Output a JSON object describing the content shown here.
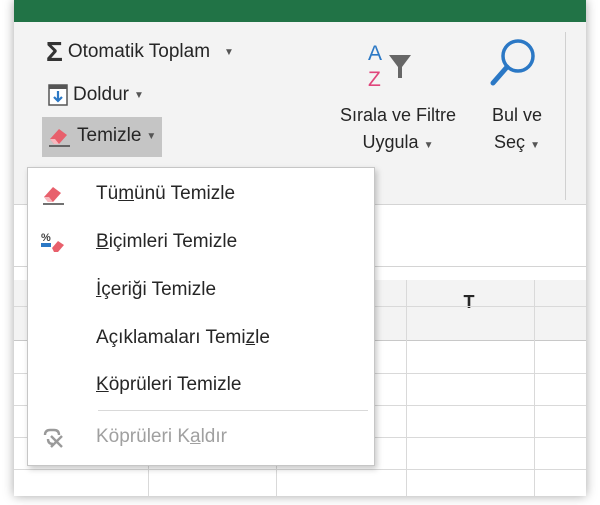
{
  "ribbon": {
    "autosum_label": "Otomatik Toplam",
    "fill_label": "Doldur",
    "clear_label": "Temizle",
    "sort_filter": {
      "line1": "Sırala ve Filtre",
      "line2": "Uygula"
    },
    "find_select": {
      "line1": "Bul ve",
      "line2": "Seç"
    }
  },
  "sheet": {
    "column_header": "T"
  },
  "menu": {
    "items": [
      {
        "pre": "Tü",
        "key": "m",
        "post": "ünü Temizle",
        "icon": "eraser-icon",
        "disabled": false
      },
      {
        "pre": "",
        "key": "B",
        "post": "içimleri Temizle",
        "icon": "clear-formats-icon",
        "disabled": false
      },
      {
        "pre": "",
        "key": "İ",
        "post": "çeriği Temizle",
        "icon": "",
        "disabled": false
      },
      {
        "pre": "Açıklamaları Temi",
        "key": "z",
        "post": "le",
        "icon": "",
        "disabled": false
      },
      {
        "pre": "",
        "key": "K",
        "post": "öprüleri Temizle",
        "icon": "",
        "disabled": false
      },
      {
        "pre": "Köprüleri K",
        "key": "a",
        "post": "ldır",
        "icon": "remove-hyperlink-icon",
        "disabled": true
      }
    ]
  },
  "colors": {
    "accent": "#217346",
    "eraser": "#e8606c",
    "find_icon": "#2b78c5"
  }
}
